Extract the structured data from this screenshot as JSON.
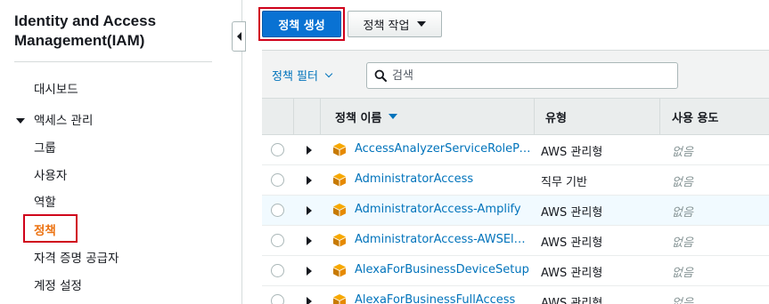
{
  "app": {
    "title": "Identity and Access Management(IAM)"
  },
  "sidebar": {
    "dashboard": "대시보드",
    "access_group": "액세스 관리",
    "items": [
      {
        "label": "그룹"
      },
      {
        "label": "사용자"
      },
      {
        "label": "역할"
      },
      {
        "label": "정책",
        "active": true
      },
      {
        "label": "자격 증명 공급자"
      },
      {
        "label": "계정 설정"
      }
    ]
  },
  "toolbar": {
    "create_label": "정책 생성",
    "actions_label": "정책 작업"
  },
  "filter": {
    "label": "정책 필터",
    "search_placeholder": "검색"
  },
  "table": {
    "columns": {
      "name": "정책 이름",
      "type": "유형",
      "usage": "사용 용도"
    },
    "rows": [
      {
        "name": "AccessAnalyzerServiceRolePolicy",
        "type": "AWS 관리형",
        "usage": "없음"
      },
      {
        "name": "AdministratorAccess",
        "type": "직무 기반",
        "usage": "없음"
      },
      {
        "name": "AdministratorAccess-Amplify",
        "type": "AWS 관리형",
        "usage": "없음"
      },
      {
        "name": "AdministratorAccess-AWSElasticBeanstalk",
        "type": "AWS 관리형",
        "usage": "없음"
      },
      {
        "name": "AlexaForBusinessDeviceSetup",
        "type": "AWS 관리형",
        "usage": "없음"
      },
      {
        "name": "AlexaForBusinessFullAccess",
        "type": "AWS 관리형",
        "usage": "없음"
      }
    ]
  },
  "colors": {
    "primary": "#0972d3",
    "link": "#0073bb",
    "active_nav": "#ec7211",
    "highlight_box": "#d0021b",
    "policy_icon": "#f7a800"
  }
}
